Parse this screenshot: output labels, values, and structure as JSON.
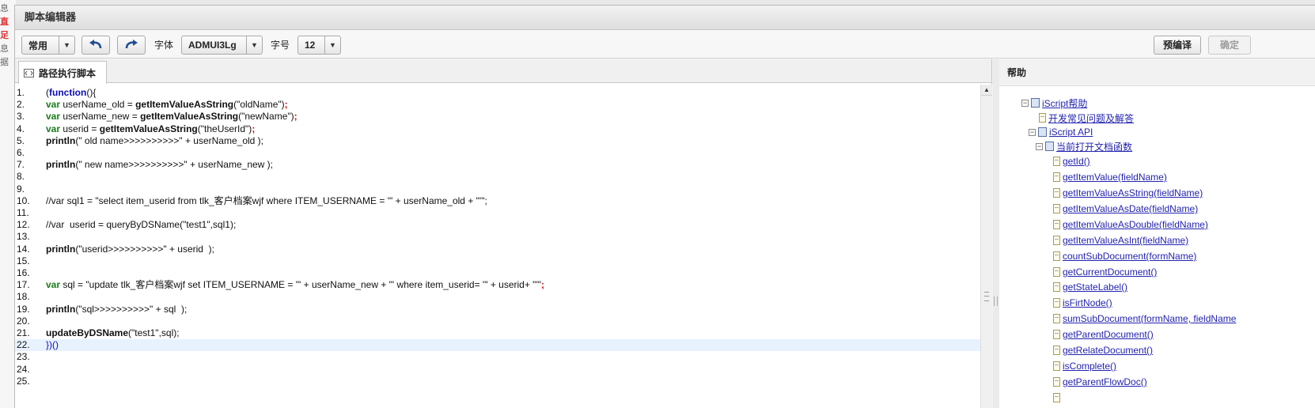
{
  "background": {
    "left_chars": [
      "息",
      "直足",
      "息",
      "据"
    ]
  },
  "dialog": {
    "title": "脚本编辑器"
  },
  "toolbar": {
    "mode_select": "常用",
    "undo_icon": "undo-icon",
    "redo_icon": "redo-icon",
    "font_label": "字体",
    "font_select": "ADMUI3Lg",
    "size_label": "字号",
    "size_select": "12",
    "precompile_button": "预编译",
    "confirm_button": "确定"
  },
  "editor": {
    "tab_label": "路径执行脚本",
    "active_line": 22,
    "lines": [
      {
        "n": "1."
      },
      {
        "n": "2."
      },
      {
        "n": "3."
      },
      {
        "n": "4."
      },
      {
        "n": "5."
      },
      {
        "n": "6."
      },
      {
        "n": "7."
      },
      {
        "n": "8."
      },
      {
        "n": "9."
      },
      {
        "n": "10."
      },
      {
        "n": "11."
      },
      {
        "n": "12."
      },
      {
        "n": "13."
      },
      {
        "n": "14."
      },
      {
        "n": "15."
      },
      {
        "n": "16."
      },
      {
        "n": "17."
      },
      {
        "n": "18."
      },
      {
        "n": "19."
      },
      {
        "n": "20."
      },
      {
        "n": "21."
      },
      {
        "n": "22."
      },
      {
        "n": "23."
      },
      {
        "n": "24."
      },
      {
        "n": "25."
      }
    ],
    "code": {
      "l1a": "(",
      "l1b": "function",
      "l1c": "(){",
      "l2a": "var",
      "l2b": " userName_old = ",
      "l2c": "getItemValueAsString",
      "l2d": "(\"oldName\")",
      "l2e": ";",
      "l3a": "var",
      "l3b": " userName_new = ",
      "l3c": "getItemValueAsString",
      "l3d": "(\"newName\")",
      "l3e": ";",
      "l4a": "var",
      "l4b": " userid = ",
      "l4c": "getItemValueAsString",
      "l4d": "(\"theUserId\")",
      "l4e": ";",
      "l5a": "println",
      "l5b": "(\" old name>>>>>>>>>>\" + userName_old );",
      "l7a": "println",
      "l7b": "(\" new name>>>>>>>>>>\" + userName_new );",
      "l10": "//var sql1 = \"select item_userid from tlk_客户档案wjf where ITEM_USERNAME = '\" + userName_old + \"'\";",
      "l12": "//var  userid = queryByDSName(\"test1\",sql1);",
      "l14a": "println",
      "l14b": "(\"userid>>>>>>>>>>\" + userid  );",
      "l17a": "var",
      "l17b": " sql = \"update tlk_客户档案wjf set ITEM_USERNAME = '\" + userName_new + \"' where item_userid= '\" + userid+ \"'\"",
      "l17c": ";",
      "l19a": "println",
      "l19b": "(\"sql>>>>>>>>>>\" + sql  );",
      "l21a": "updateByDSName",
      "l21b": "(\"test1\",sql);",
      "l22": "})()"
    }
  },
  "help": {
    "title": "帮助",
    "tree": [
      {
        "label": "iScript帮助",
        "kind": "book",
        "toggle": "⊟"
      },
      {
        "label": "开发常见问题及解答",
        "kind": "doc"
      },
      {
        "label": "iScript API",
        "kind": "book",
        "toggle": "⊟"
      },
      {
        "label": "当前打开文档函数",
        "kind": "book",
        "toggle": "⊟"
      },
      {
        "label": "getId()",
        "kind": "doc"
      },
      {
        "label": "getItemValue(fieldName)",
        "kind": "doc"
      },
      {
        "label": "getItemValueAsString(fieldName)",
        "kind": "doc"
      },
      {
        "label": "getItemValueAsDate(fieldName)",
        "kind": "doc"
      },
      {
        "label": "getItemValueAsDouble(fieldName)",
        "kind": "doc"
      },
      {
        "label": "getItemValueAsInt(fieldName)",
        "kind": "doc"
      },
      {
        "label": "countSubDocument(formName)",
        "kind": "doc"
      },
      {
        "label": "getCurrentDocument()",
        "kind": "doc"
      },
      {
        "label": "getStateLabel()",
        "kind": "doc"
      },
      {
        "label": "isFirtNode()",
        "kind": "doc"
      },
      {
        "label": "sumSubDocument(formName, fieldName",
        "kind": "doc"
      },
      {
        "label": "getParentDocument()",
        "kind": "doc"
      },
      {
        "label": "getRelateDocument()",
        "kind": "doc"
      },
      {
        "label": "isComplete()",
        "kind": "doc"
      },
      {
        "label": "getParentFlowDoc()",
        "kind": "doc"
      }
    ]
  }
}
